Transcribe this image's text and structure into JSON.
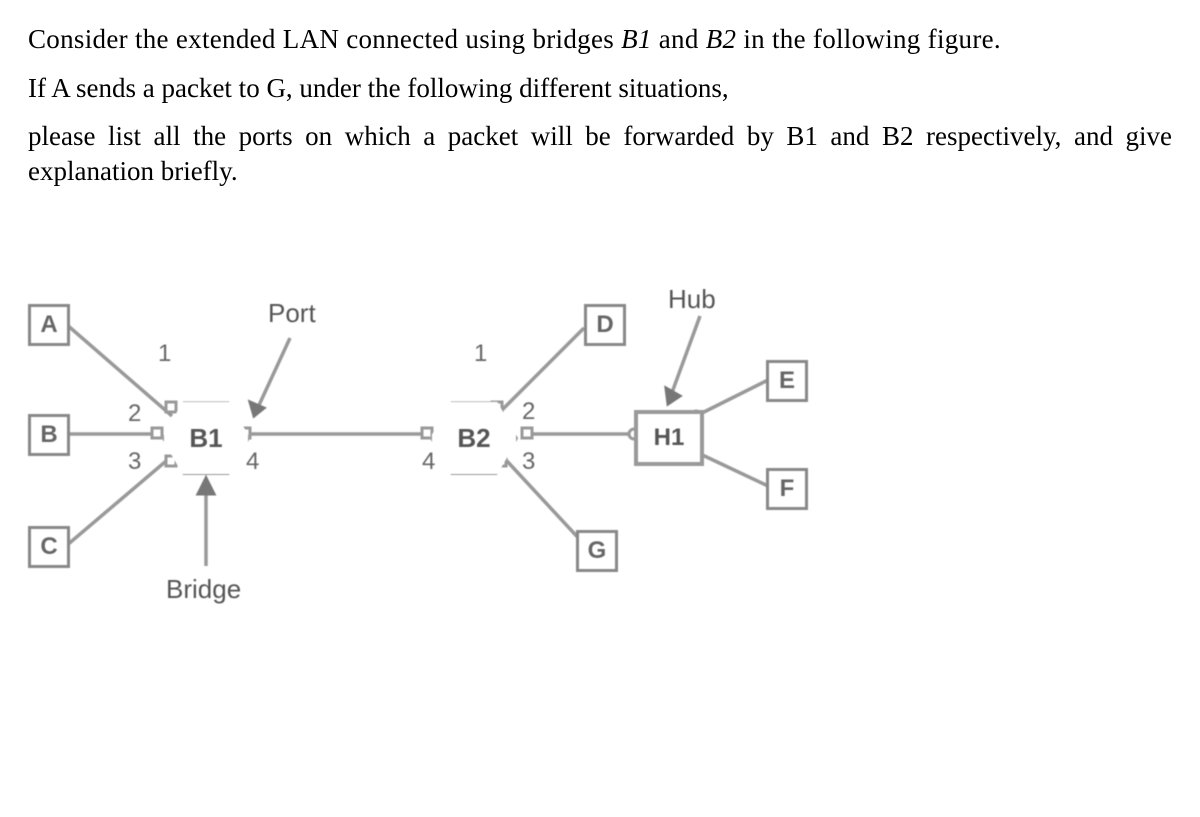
{
  "intro": {
    "p1a": "Consider the extended LAN connected using bridges ",
    "b1": "B1",
    "p1b": " and ",
    "b2": "B2",
    "p1c": " in the following figure.",
    "p2": "If A sends a packet to G, under the following different situations,",
    "p3": "please list all the ports on which a packet will be forwarded by B1 and B2 respectively, and give explanation briefly."
  },
  "diagram": {
    "hosts": {
      "A": "A",
      "B": "B",
      "C": "C",
      "D": "D",
      "E": "E",
      "F": "F",
      "G": "G"
    },
    "bridges": {
      "B1": "B1",
      "B2": "B2"
    },
    "hub": "H1",
    "labels": {
      "port": "Port",
      "bridge": "Bridge",
      "hub": "Hub"
    },
    "ports": {
      "B1": {
        "p1": "1",
        "p2": "2",
        "p3": "3",
        "p4": "4"
      },
      "B2": {
        "p1": "1",
        "p2": "2",
        "p3": "3",
        "p4": "4"
      }
    }
  }
}
